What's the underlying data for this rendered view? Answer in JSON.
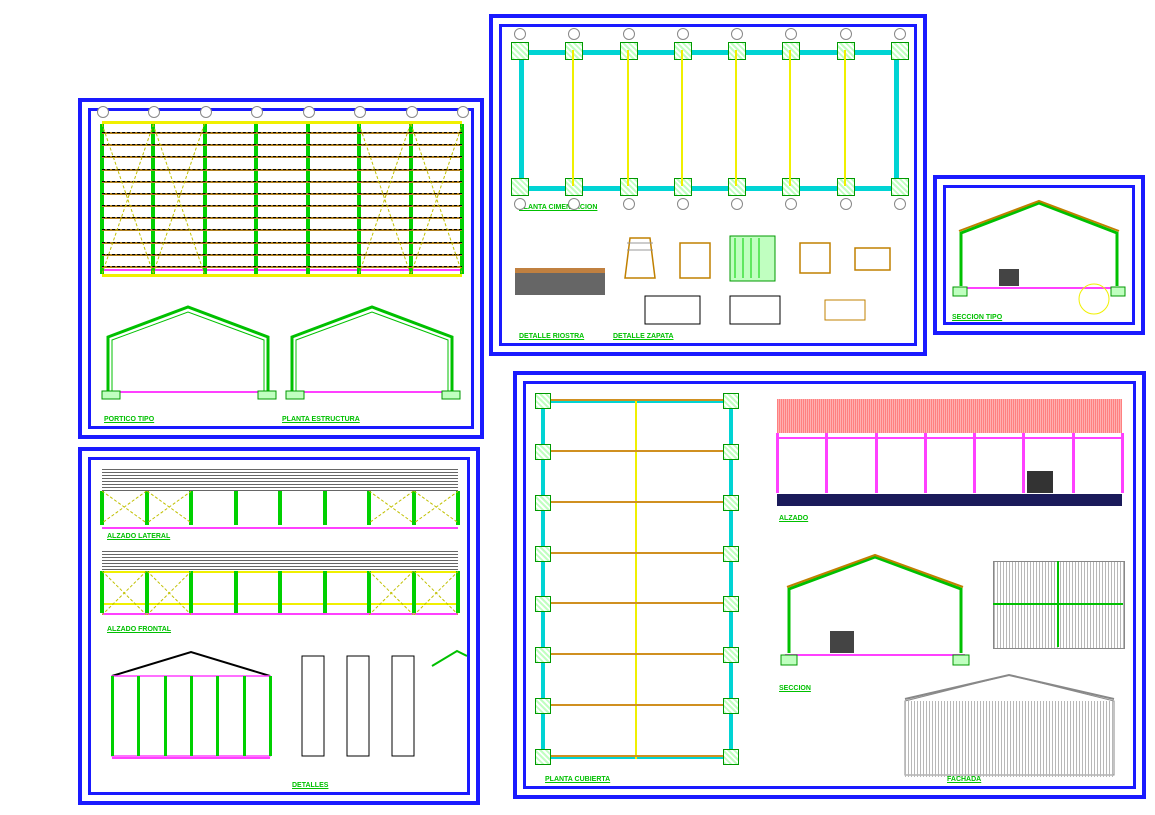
{
  "panels": {
    "p1": {
      "caption1": "PORTICO TIPO",
      "caption2": "PLANTA ESTRUCTURA"
    },
    "p2": {
      "caption1": "PLANTA CIMENTACION",
      "caption2": "DETALLE ZAPATA",
      "caption3": "DETALLE RIOSTRA"
    },
    "p3": {
      "caption1": "ALZADO LATERAL",
      "caption2": "ALZADO FRONTAL",
      "caption3": "DETALLES"
    },
    "p4": {
      "caption1": "PLANTA CUBIERTA",
      "caption2": "ALZADO",
      "caption3": "SECCION",
      "caption4": "FACHADA"
    },
    "p5": {
      "caption1": "SECCION TIPO"
    }
  },
  "colors": {
    "frame": "#1a1aff",
    "steel": "#00d000",
    "dim": "#888888",
    "brace": "#c0c000",
    "cyan": "#00d4d4",
    "mag": "#ff40ff"
  }
}
